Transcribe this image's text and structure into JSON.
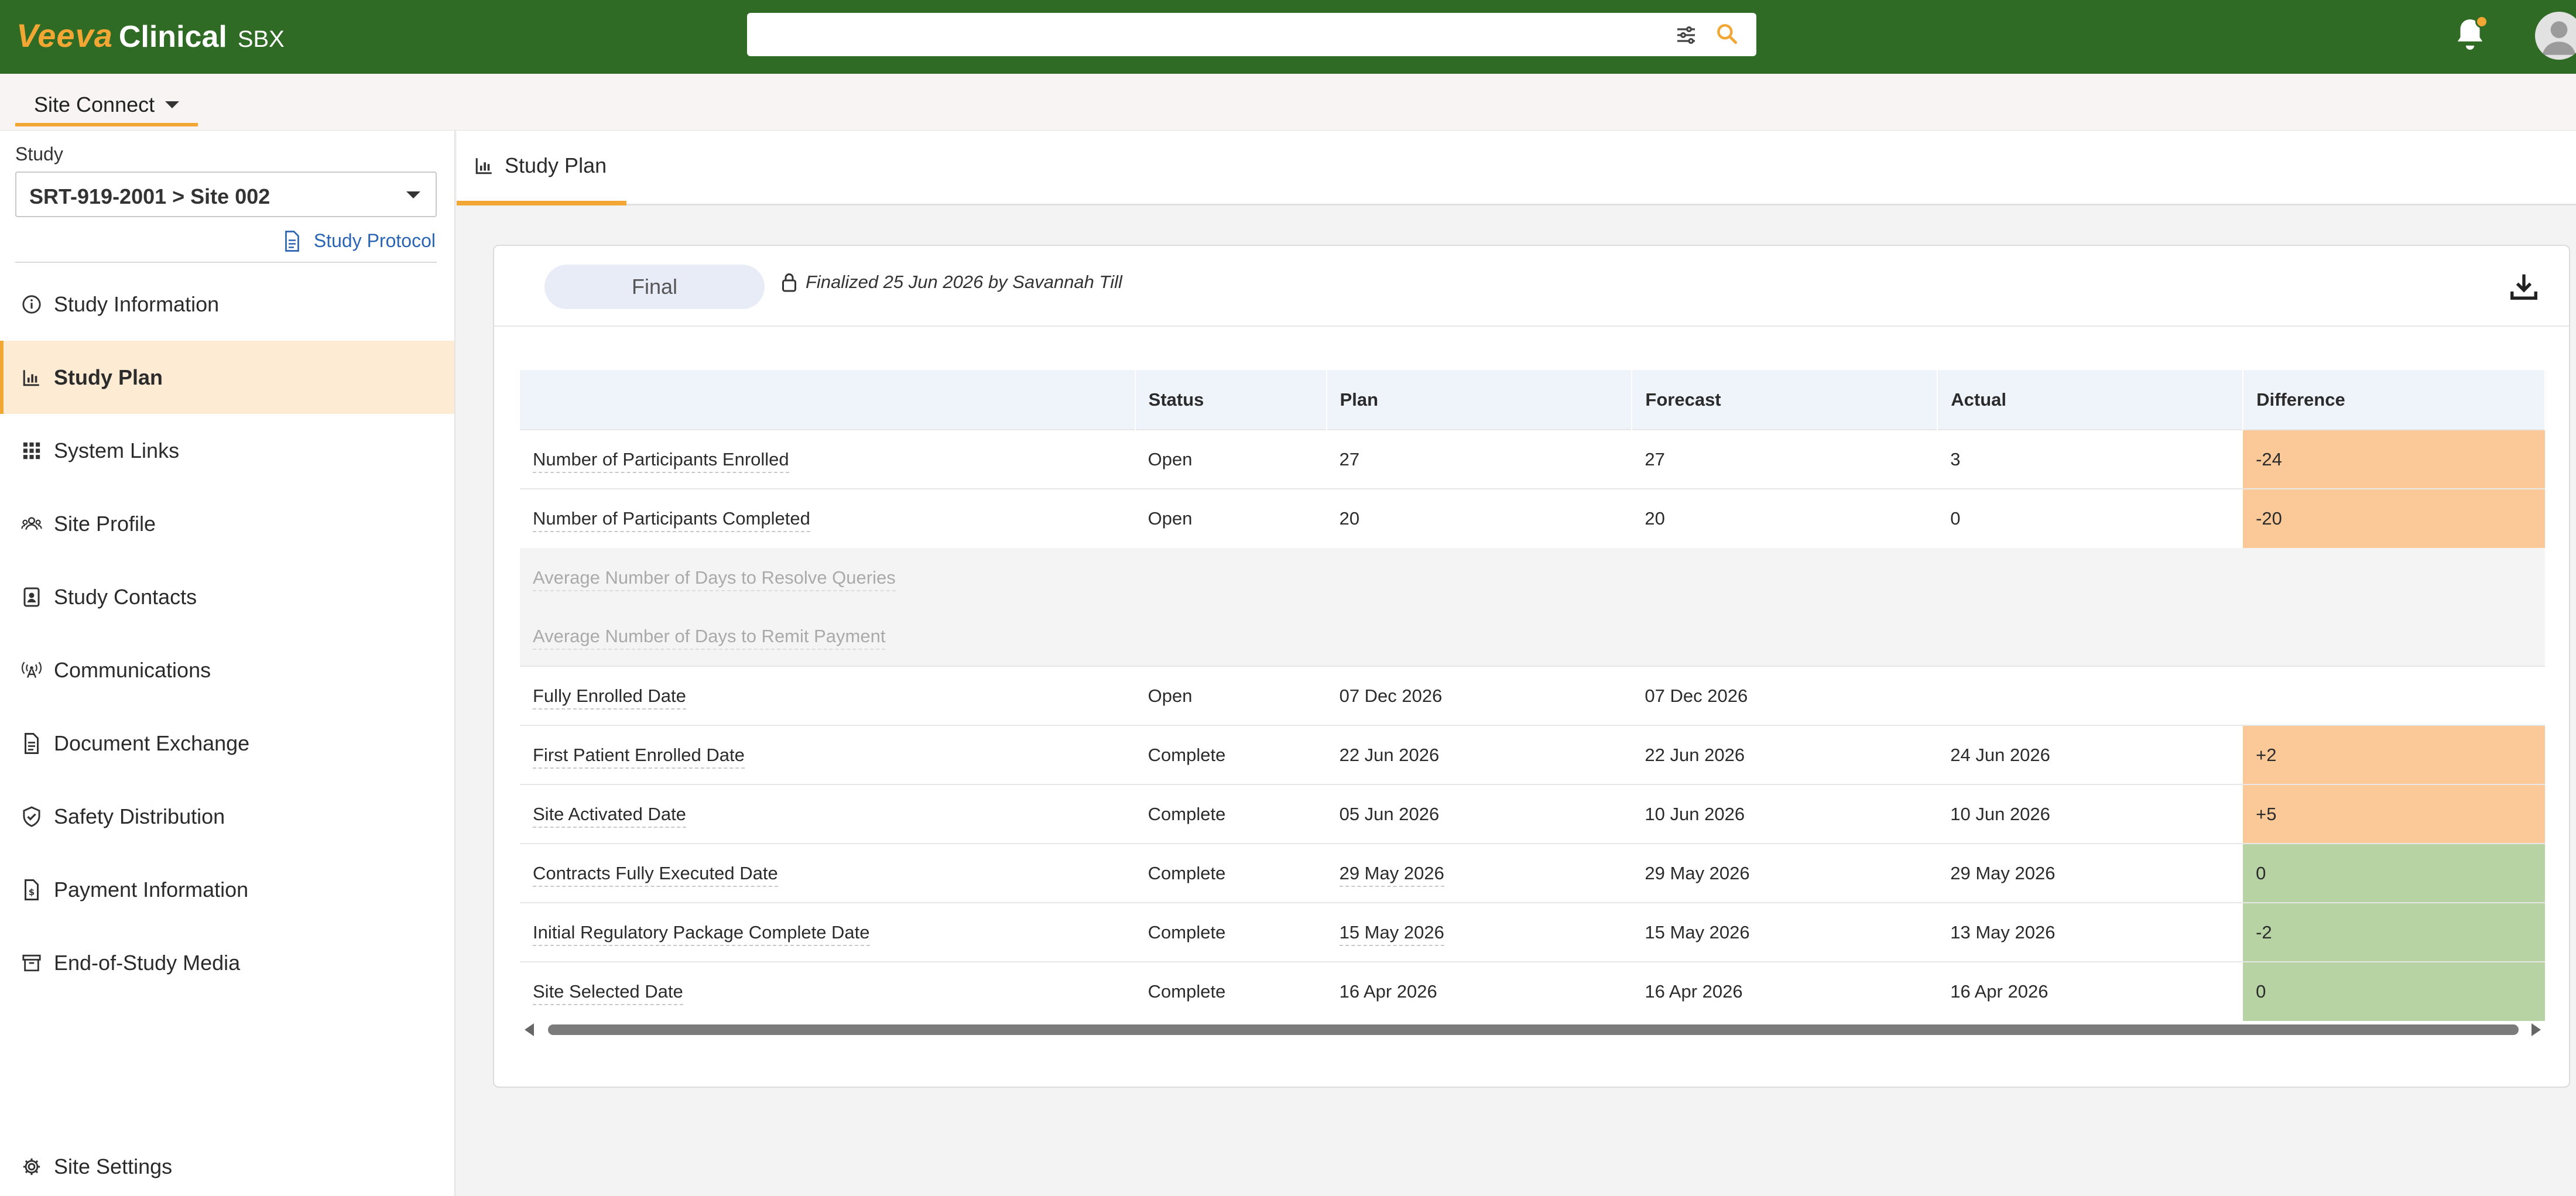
{
  "app": {
    "brand": "Veeva",
    "product": "Clinical",
    "env": "SBX"
  },
  "search": {
    "placeholder": ""
  },
  "subnav": {
    "label": "Site Connect"
  },
  "sidebar": {
    "study_label": "Study",
    "study_value": "SRT-919-2001 > Site 002",
    "protocol_link": "Study Protocol",
    "items": [
      {
        "label": "Study Information",
        "icon": "info-icon"
      },
      {
        "label": "Study Plan",
        "icon": "bar-chart-icon",
        "active": true
      },
      {
        "label": "System Links",
        "icon": "grid-icon"
      },
      {
        "label": "Site Profile",
        "icon": "people-icon"
      },
      {
        "label": "Study Contacts",
        "icon": "contact-book-icon"
      },
      {
        "label": "Communications",
        "icon": "broadcast-icon"
      },
      {
        "label": "Document Exchange",
        "icon": "document-icon"
      },
      {
        "label": "Safety Distribution",
        "icon": "shield-check-icon"
      },
      {
        "label": "Payment Information",
        "icon": "payment-doc-icon"
      },
      {
        "label": "End-of-Study Media",
        "icon": "archive-box-icon"
      }
    ],
    "settings": "Site Settings"
  },
  "tab": {
    "label": "Study Plan"
  },
  "plan": {
    "status_pill": "Final",
    "finalized_text": "Finalized 25 Jun 2026 by Savannah Till",
    "columns": [
      "",
      "Status",
      "Plan",
      "Forecast",
      "Actual",
      "Difference"
    ],
    "rows": [
      {
        "metric": "Number of Participants Enrolled",
        "status": "Open",
        "plan": "27",
        "forecast": "27",
        "actual": "3",
        "difference": "-24"
      },
      {
        "metric": "Number of Participants Completed",
        "status": "Open",
        "plan": "20",
        "forecast": "20",
        "actual": "0",
        "difference": "-20"
      },
      {
        "metric": "Average Number of Days to Resolve Queries",
        "status": "",
        "plan": "",
        "forecast": "",
        "actual": "",
        "difference": ""
      },
      {
        "metric": "Average Number of Days to Remit Payment",
        "status": "",
        "plan": "",
        "forecast": "",
        "actual": "",
        "difference": ""
      },
      {
        "metric": "Fully Enrolled Date",
        "status": "Open",
        "plan": "07 Dec 2026",
        "forecast": "07 Dec 2026",
        "actual": "",
        "difference": ""
      },
      {
        "metric": "First Patient Enrolled Date",
        "status": "Complete",
        "plan": "22 Jun 2026",
        "forecast": "22 Jun 2026",
        "actual": "24 Jun 2026",
        "difference": "+2"
      },
      {
        "metric": "Site Activated Date",
        "status": "Complete",
        "plan": "05 Jun 2026",
        "forecast": "10 Jun 2026",
        "actual": "10 Jun 2026",
        "difference": "+5"
      },
      {
        "metric": "Contracts Fully Executed Date",
        "status": "Complete",
        "plan": "29 May 2026",
        "forecast": "29 May 2026",
        "actual": "29 May 2026",
        "difference": "0"
      },
      {
        "metric": "Initial Regulatory Package Complete Date",
        "status": "Complete",
        "plan": "15 May 2026",
        "forecast": "15 May 2026",
        "actual": "13 May 2026",
        "difference": "-2"
      },
      {
        "metric": "Site Selected Date",
        "status": "Complete",
        "plan": "16 Apr 2026",
        "forecast": "16 Apr 2026",
        "actual": "16 Apr 2026",
        "difference": "0"
      }
    ]
  },
  "colors": {
    "brand_green": "#2f6b25",
    "accent_orange": "#f2a735",
    "diff_orange": "#fbc998",
    "diff_green": "#b7d3a4"
  }
}
